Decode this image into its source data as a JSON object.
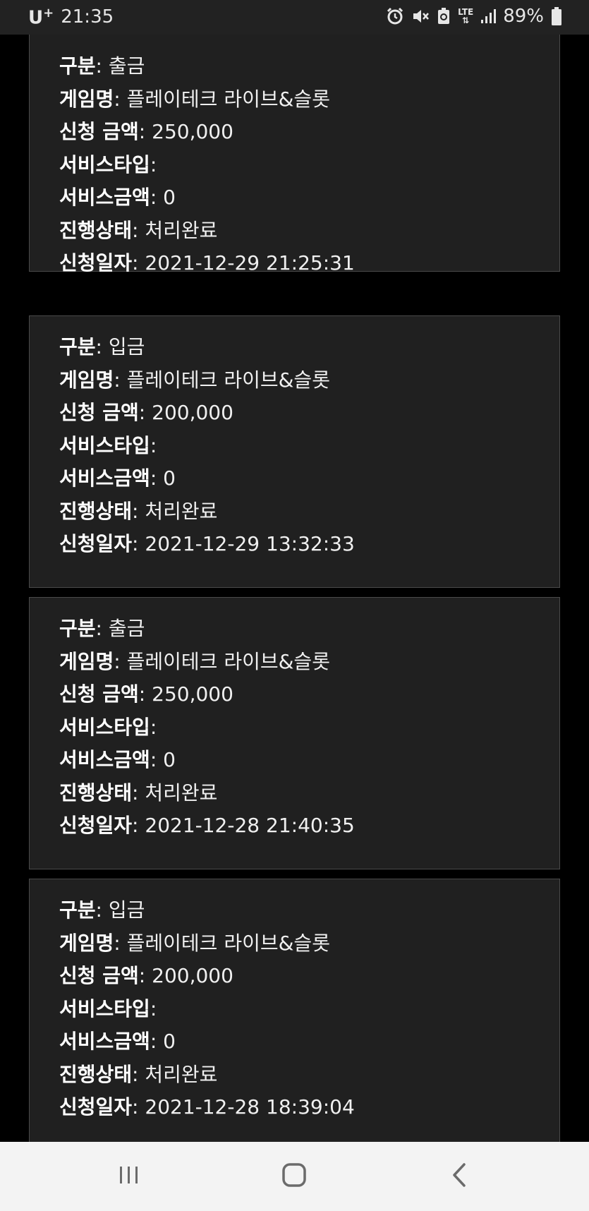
{
  "status_bar": {
    "carrier": "U",
    "carrier_sup": "+",
    "time": "21:35",
    "network": "LTE",
    "battery": "89%",
    "icons": [
      "alarm-icon",
      "mute-icon",
      "battery-saver-icon",
      "lte-icon",
      "signal-icon",
      "battery-icon"
    ]
  },
  "cards": [
    {
      "rows": [
        {
          "key": "구분",
          "value": " 출금"
        },
        {
          "key": "게임명",
          "value": " 플레이테크 라이브&슬롯"
        },
        {
          "key": "신청 금액",
          "value": " 250,000"
        },
        {
          "key": "서비스타입",
          "value": ""
        },
        {
          "key": "서비스금액",
          "value": " 0"
        },
        {
          "key": "진행상태",
          "value": " 처리완료"
        },
        {
          "key": "신청일자",
          "value": " 2021-12-29 21:25:31"
        }
      ]
    },
    {
      "rows": [
        {
          "key": "구분",
          "value": " 입금"
        },
        {
          "key": "게임명",
          "value": " 플레이테크 라이브&슬롯"
        },
        {
          "key": "신청 금액",
          "value": " 200,000"
        },
        {
          "key": "서비스타입",
          "value": ""
        },
        {
          "key": "서비스금액",
          "value": " 0"
        },
        {
          "key": "진행상태",
          "value": " 처리완료"
        },
        {
          "key": "신청일자",
          "value": " 2021-12-29 13:32:33"
        }
      ]
    },
    {
      "rows": [
        {
          "key": "구분",
          "value": " 출금"
        },
        {
          "key": "게임명",
          "value": " 플레이테크 라이브&슬롯"
        },
        {
          "key": "신청 금액",
          "value": " 250,000"
        },
        {
          "key": "서비스타입",
          "value": ""
        },
        {
          "key": "서비스금액",
          "value": " 0"
        },
        {
          "key": "진행상태",
          "value": " 처리완료"
        },
        {
          "key": "신청일자",
          "value": " 2021-12-28 21:40:35"
        }
      ]
    },
    {
      "rows": [
        {
          "key": "구분",
          "value": " 입금"
        },
        {
          "key": "게임명",
          "value": " 플레이테크 라이브&슬롯"
        },
        {
          "key": "신청 금액",
          "value": " 200,000"
        },
        {
          "key": "서비스타입",
          "value": ""
        },
        {
          "key": "서비스금액",
          "value": " 0"
        },
        {
          "key": "진행상태",
          "value": " 처리완료"
        },
        {
          "key": "신청일자",
          "value": " 2021-12-28 18:39:04"
        }
      ]
    }
  ],
  "nav_bar": {
    "icons": [
      "recents-icon",
      "home-icon",
      "back-icon"
    ]
  }
}
